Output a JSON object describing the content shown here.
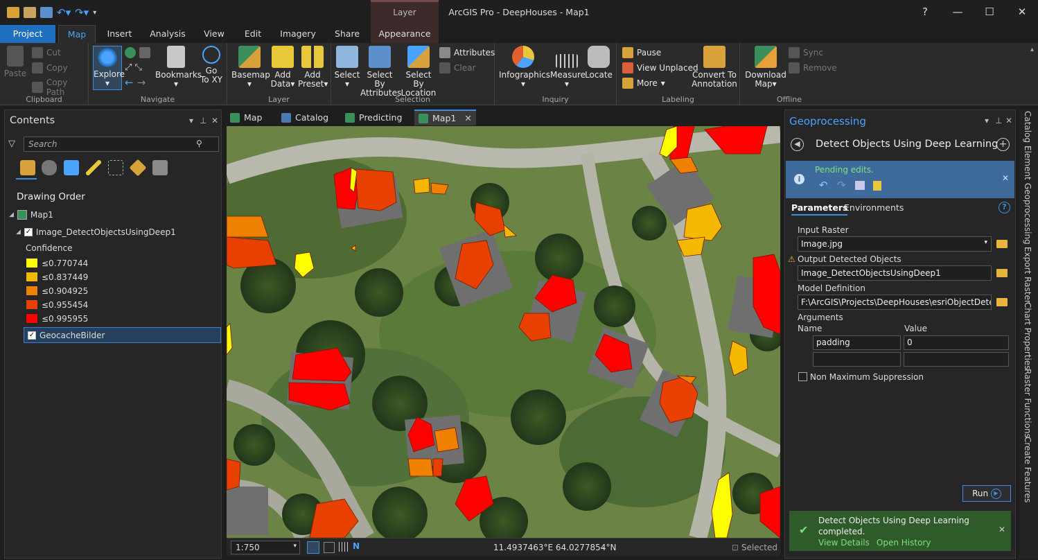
{
  "app": {
    "title": "ArcGIS Pro - DeepHouses - Map1",
    "context_tab_group": "Layer",
    "help": "?",
    "minimize": "—",
    "maximize": "☐",
    "close": "✕"
  },
  "ribbon_tabs": [
    "Project",
    "Map",
    "Insert",
    "Analysis",
    "View",
    "Edit",
    "Imagery",
    "Share",
    "Appearance"
  ],
  "ribbon": {
    "clipboard": {
      "label": "Clipboard",
      "paste": "Paste",
      "cut": "Cut",
      "copy": "Copy",
      "copy_path": "Copy Path"
    },
    "navigate": {
      "label": "Navigate",
      "explore": "Explore",
      "bookmarks": "Bookmarks",
      "go_to_xy_1": "Go",
      "go_to_xy_2": "To XY"
    },
    "layer": {
      "label": "Layer",
      "basemap": "Basemap",
      "add_data_1": "Add",
      "add_data_2": "Data",
      "add_preset_1": "Add",
      "add_preset_2": "Preset"
    },
    "selection": {
      "label": "Selection",
      "select": "Select",
      "select_by_attr_1": "Select By",
      "select_by_attr_2": "Attributes",
      "select_by_loc_1": "Select By",
      "select_by_loc_2": "Location",
      "attributes": "Attributes",
      "clear": "Clear"
    },
    "inquiry": {
      "label": "Inquiry",
      "infographics": "Infographics",
      "measure": "Measure",
      "locate": "Locate"
    },
    "labeling": {
      "label": "Labeling",
      "pause": "Pause",
      "view_unplaced": "View Unplaced",
      "more": "More",
      "convert_1": "Convert To",
      "convert_2": "Annotation"
    },
    "offline": {
      "label": "Offline",
      "download_1": "Download",
      "download_2": "Map",
      "sync": "Sync",
      "remove": "Remove"
    }
  },
  "contents": {
    "title": "Contents",
    "search_placeholder": "Search",
    "drawing_order": "Drawing Order",
    "map_name": "Map1",
    "layer_name": "Image_DetectObjectsUsingDeep1",
    "field_name": "Confidence",
    "legend": [
      {
        "label": "≤0.770744",
        "color": "#ffff00"
      },
      {
        "label": "≤0.837449",
        "color": "#f5b800"
      },
      {
        "label": "≤0.904925",
        "color": "#f08000"
      },
      {
        "label": "≤0.955454",
        "color": "#e84000"
      },
      {
        "label": "≤0.995955",
        "color": "#ff0000"
      }
    ],
    "layer2_name": "GeocacheBilder"
  },
  "view_tabs": [
    "Map",
    "Catalog",
    "Predicting",
    "Map1"
  ],
  "status": {
    "scale": "1:750",
    "coords": "11.4937463°E 64.0277854°N",
    "selected": "Selected"
  },
  "geoprocessing": {
    "title": "Geoprocessing",
    "tool_title": "Detect Objects Using Deep Learning",
    "pending": "Pending edits.",
    "tab_parameters": "Parameters",
    "tab_environments": "Environments",
    "input_raster_label": "Input Raster",
    "input_raster": "Image.jpg",
    "output_label": "Output Detected Objects",
    "output": "Image_DetectObjectsUsingDeep1",
    "model_label": "Model Definition",
    "model": "F:\\ArcGIS\\Projects\\DeepHouses\\esriObjectDetection",
    "arguments_label": "Arguments",
    "col_name": "Name",
    "col_value": "Value",
    "arg_name": "padding",
    "arg_value": "0",
    "nms_label": "Non Maximum Suppression",
    "run": "Run",
    "done_msg": "Detect Objects Using Deep Learning completed.",
    "view_details": "View Details",
    "open_history": "Open History"
  },
  "right_dock": [
    "Catalog",
    "Element",
    "Geoprocessing",
    "Export Raster",
    "Chart Properties",
    "Raster Functions",
    "Create Features"
  ]
}
